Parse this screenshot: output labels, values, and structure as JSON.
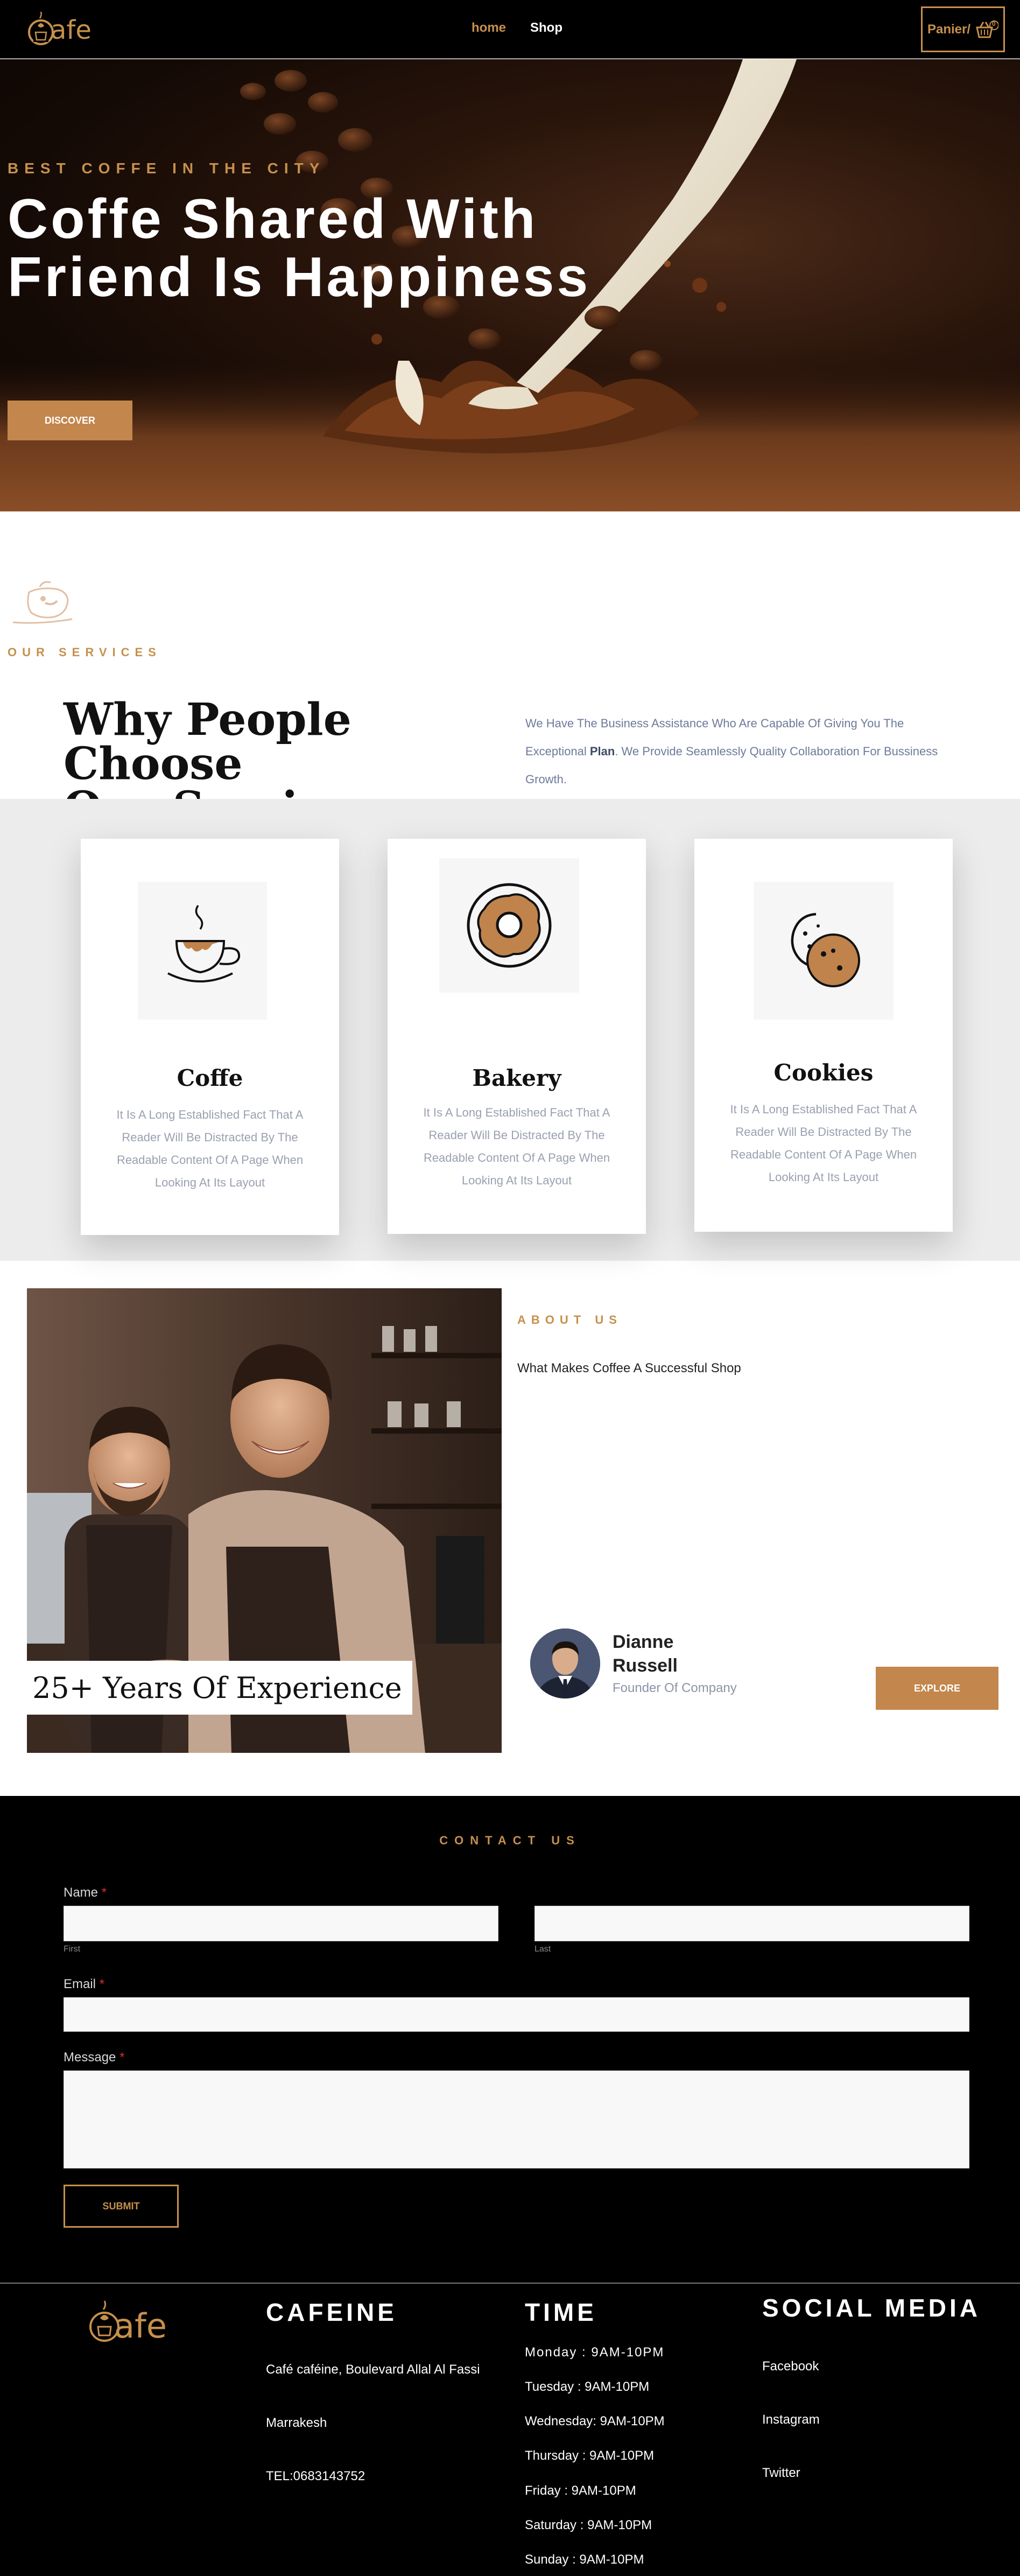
{
  "nav": {
    "logo_text": "afe",
    "home": "home",
    "shop": "Shop",
    "cart_label": "Panier/",
    "cart_count": "0"
  },
  "hero": {
    "kicker": "BEST COFFE IN THE CITY",
    "title_line1": "Coffe Shared With",
    "title_line2": "Friend Is Happiness",
    "cta": "DISCOVER"
  },
  "services": {
    "kicker": "OUR SERVICES",
    "title_line1": "Why People Choose",
    "title_line2": "Our Services",
    "desc_part1": "We Have The Business Assistance Who Are Capable Of Giving You The Exceptional ",
    "desc_bold": "Plan",
    "desc_part2": ". We Provide Seamlessly Quality Collaboration For Bussiness Growth.",
    "cards": [
      {
        "title": "Coffe",
        "text": "It Is A Long Established Fact That A Reader Will Be Distracted By The Readable Content Of A Page When Looking At Its Layout",
        "icon": "coffee-cup-icon"
      },
      {
        "title": "Bakery",
        "text": "It Is A Long Established Fact That A Reader Will Be Distracted By The Readable Content Of A Page When Looking At Its Layout",
        "icon": "donut-icon"
      },
      {
        "title": "Cookies",
        "text": "It Is A Long Established Fact That A Reader Will Be Distracted By The Readable Content Of A Page When Looking At Its Layout",
        "icon": "cookie-icon"
      }
    ]
  },
  "about": {
    "kicker": "ABOUT US",
    "subtitle": "What Makes Coffee A Successful Shop",
    "experience": "25+ Years Of Experience",
    "person_name_line1": "Dianne",
    "person_name_line2": "Russell",
    "person_role": "Founder Of Company",
    "cta": "EXPLORE"
  },
  "contact": {
    "kicker": "CONTACT US",
    "name_label": "Name",
    "first_hint": "First",
    "last_hint": "Last",
    "email_label": "Email",
    "message_label": "Message",
    "required_mark": "*",
    "first_value": "",
    "last_value": "",
    "email_value": "",
    "message_value": "",
    "submit": "SUBMIT"
  },
  "footer": {
    "logo_text": "afe",
    "brand_heading": "CAFEINE",
    "address": "Café caféine, Boulevard Allal Al Fassi",
    "city": "Marrakesh",
    "phone": "TEL:0683143752",
    "time_heading": "TIME",
    "hours": [
      "Monday : 9AM-10PM",
      "Tuesday : 9AM-10PM",
      "Wednesday: 9AM-10PM",
      "Thursday : 9AM-10PM",
      "Friday : 9AM-10PM",
      "Saturday : 9AM-10PM",
      "Sunday : 9AM-10PM"
    ],
    "social_heading": "SOCIAL MEDIA",
    "social": [
      "Facebook",
      "Instagram",
      "Twitter"
    ]
  },
  "colors": {
    "accent": "#c6904c",
    "accent_button": "#c3864c",
    "dark": "#000000",
    "band": "#ececec"
  }
}
